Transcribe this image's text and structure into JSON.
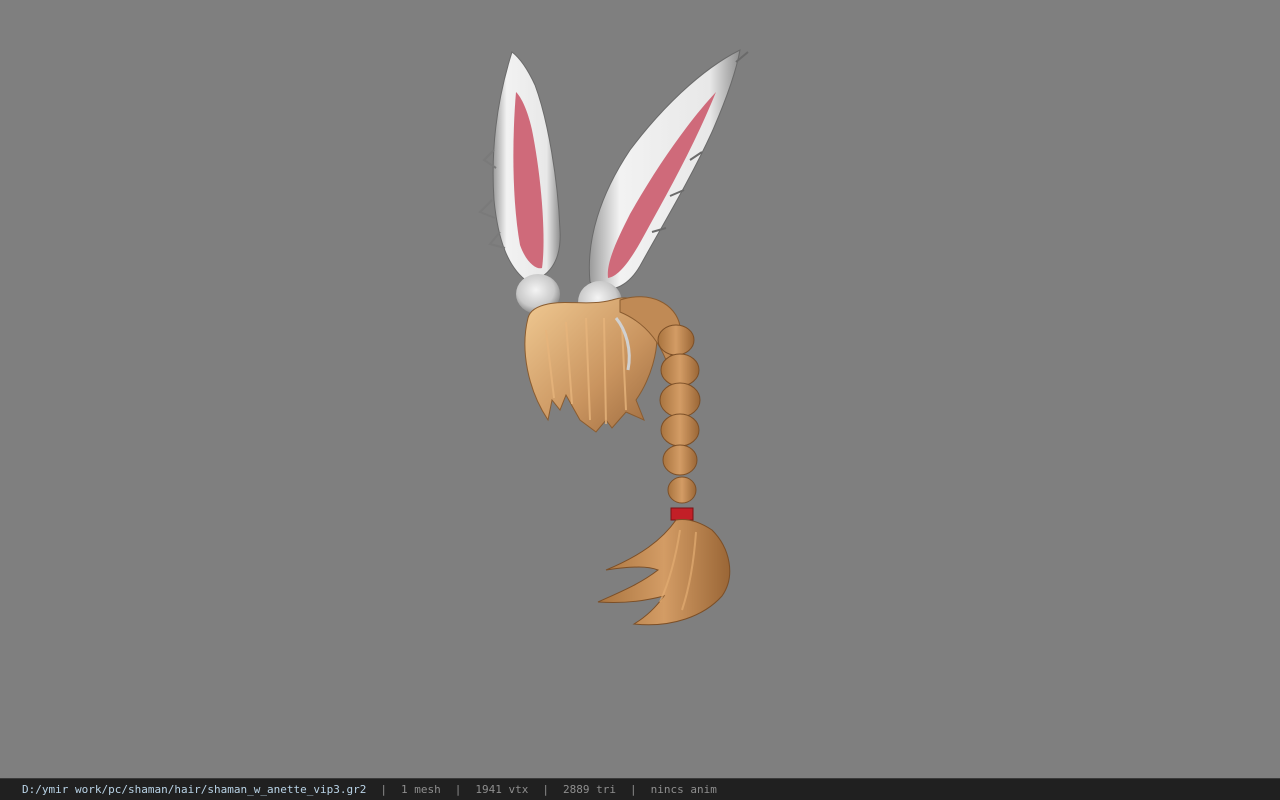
{
  "viewport": {
    "background": "#7f7f7f",
    "model": "bunny-ear-hair-braid"
  },
  "status": {
    "path": "D:/ymir work/pc/shaman/hair/shaman_w_anette_vip3.gr2",
    "separator": "|",
    "mesh": "1 mesh",
    "vertices": "1941 vtx",
    "triangles": "2889 tri",
    "anim": "nincs anim"
  },
  "colors": {
    "status_bar": "#202020",
    "path_text": "#b9d3e6",
    "status_text": "#8e8e8e",
    "hair": "#c08a55",
    "ear_outer": "#dcdcdc",
    "ear_inner": "#cf6a7a"
  }
}
